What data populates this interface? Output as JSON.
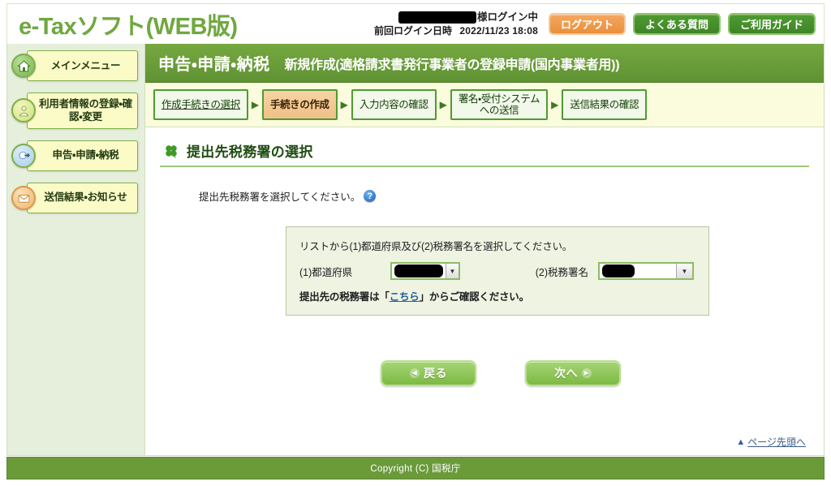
{
  "header": {
    "logo": "e-Taxソフト(WEB版)",
    "login_status_suffix": "様ログイン中",
    "last_login_label": "前回ログイン日時",
    "last_login_time": "2022/11/23 18:08",
    "logout_label": "ログアウト",
    "faq_label": "よくある質問",
    "guide_label": "ご利用ガイド"
  },
  "sidebar": {
    "items": [
      {
        "label": "メインメニュー",
        "icon": "home-icon"
      },
      {
        "label": "利用者情報の登録・確認・変更",
        "icon": "user-icon"
      },
      {
        "label": "申告・申請・納税",
        "icon": "arrow-icon"
      },
      {
        "label": "送信結果・お知らせ",
        "icon": "mail-icon"
      }
    ]
  },
  "page_title": {
    "main": "申告・申請・納税",
    "sub": "新規作成(適格請求書発行事業者の登録申請(国内事業者用))"
  },
  "steps": [
    {
      "label": "作成手続きの選択",
      "state": "link"
    },
    {
      "label": "手続きの作成",
      "state": "active"
    },
    {
      "label": "入力内容の確認",
      "state": "inactive"
    },
    {
      "label": "署名・受付システム\nへの送信",
      "state": "inactive"
    },
    {
      "label": "送信結果の確認",
      "state": "inactive"
    }
  ],
  "section": {
    "title": "提出先税務署の選択",
    "instruction": "提出先税務署を選択してください。",
    "help_glyph": "?"
  },
  "panel": {
    "lead": "リストから(1)都道府県及び(2)税務署名を選択してください。",
    "pref_label": "(1)都道府県",
    "pref_value": "",
    "office_label": "(2)税務署名",
    "office_value": "",
    "note_before": "提出先の税務署は「",
    "note_link": "こちら",
    "note_after": "」からご確認ください。",
    "dropdown_glyph": "▼"
  },
  "actions": {
    "back_label": "戻る",
    "back_glyph": "◀",
    "next_label": "次へ",
    "next_glyph": "▶"
  },
  "top_link": {
    "label": "ページ先頭へ",
    "glyph": "▲"
  },
  "footer": {
    "copyright": "Copyright (C) 国税庁"
  },
  "colors": {
    "brand_green": "#6fa83f",
    "title_bar_green": "#5f9233",
    "accent_orange": "#ea8f3c",
    "step_active": "#f0c086",
    "link_blue": "#225d9c"
  }
}
